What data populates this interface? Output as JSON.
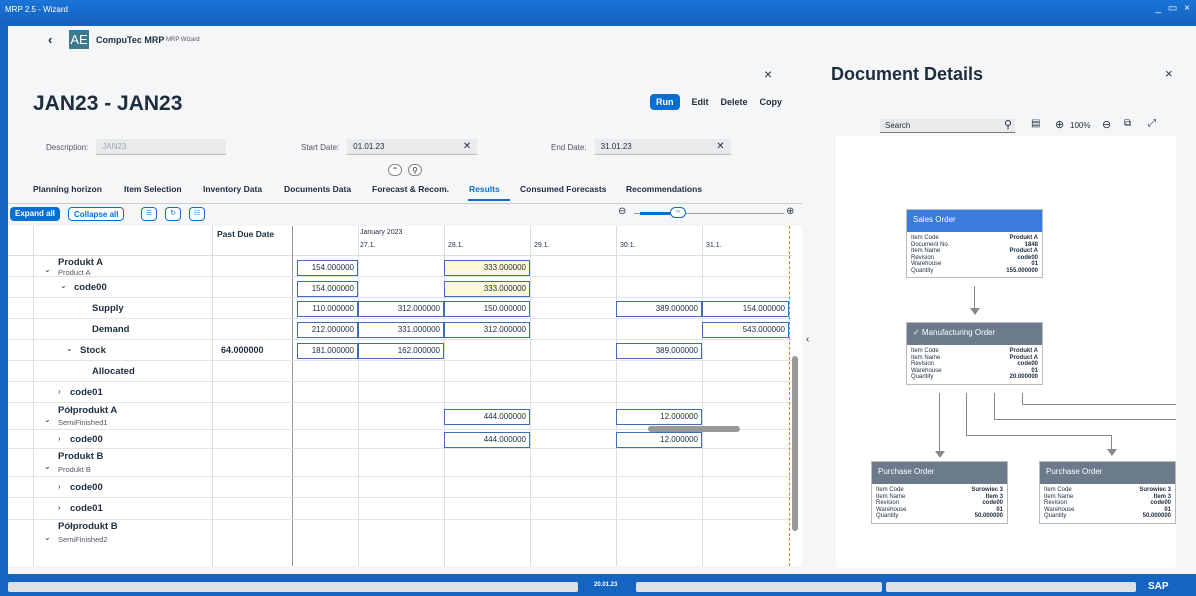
{
  "window_title": "MRP 2.5 - Wizard",
  "window_controls": "_ ▭ ×",
  "app": {
    "back": "‹",
    "logo": "AE",
    "brand": "CompuTec MRP",
    "subtitle": "MRP Wizard"
  },
  "page": {
    "title": "JAN23 - JAN23",
    "close": "×",
    "actions": {
      "run": "Run",
      "edit": "Edit",
      "delete": "Delete",
      "copy": "Copy"
    },
    "fields": {
      "description_label": "Description:",
      "description_value": "JAN23",
      "start_label": "Start Date:",
      "start_value": "01.01.23",
      "end_label": "End Date:",
      "end_value": "31.01.23"
    }
  },
  "tabs": [
    "Planning horizon",
    "Item Selection",
    "Inventory Data",
    "Documents Data",
    "Forecast & Recom.",
    "Results",
    "Consumed Forecasts",
    "Recommendations"
  ],
  "active_tab": "Results",
  "toolbar": {
    "expand_all": "Expand all",
    "collapse_all": "Collapse all"
  },
  "grid": {
    "past_due_header": "Past Due Date",
    "month": "January 2023",
    "days": [
      "27.1.",
      "28.1.",
      "29.1.",
      "30.1.",
      "31.1."
    ],
    "rows": [
      {
        "label": "Produkt A",
        "sub": "Product A"
      },
      {
        "label": "code00"
      },
      {
        "label": "Supply"
      },
      {
        "label": "Demand"
      },
      {
        "label": "Stock",
        "past_due": "64.000000"
      },
      {
        "label": "Allocated"
      },
      {
        "label": "code01"
      },
      {
        "label": "Półprodukt A",
        "sub": "SemiFinished1"
      },
      {
        "label": "code00"
      },
      {
        "label": "Produkt B",
        "sub": "Produkt B"
      },
      {
        "label": "code00"
      },
      {
        "label": "code01"
      },
      {
        "label": "Półprodukt B",
        "sub": "SemiFinished2"
      }
    ],
    "values": [
      "154.000000",
      "333.000000",
      "154.000000",
      "333.000000",
      "110.000000",
      "312.000000",
      "150.000000",
      "389.000000",
      "154.000000",
      "212.000000",
      "331.000000",
      "312.000000",
      "543.000000",
      "181.000000",
      "162.000000",
      "389.000000",
      "444.000000",
      "12.000000",
      "444.000000",
      "12.000000"
    ]
  },
  "details": {
    "title": "Document Details",
    "close": "×",
    "search_placeholder": "Search",
    "zoom": "100%",
    "sales_order": {
      "title": "Sales Order",
      "fields": [
        [
          "Item Code",
          "Produkt A"
        ],
        [
          "Document No.",
          "1848"
        ],
        [
          "Item Name",
          "Product A"
        ],
        [
          "Revision",
          "code00"
        ],
        [
          "Warehouse",
          "01"
        ],
        [
          "Quantity",
          "155.000000"
        ]
      ]
    },
    "manufacturing_order": {
      "title": "✓ Manufacturing Order",
      "fields": [
        [
          "Item Code",
          "Produkt A"
        ],
        [
          "Item Name",
          "Product A"
        ],
        [
          "Revision",
          "code00"
        ],
        [
          "Warehouse",
          "01"
        ],
        [
          "Quantity",
          "20.000000"
        ]
      ]
    },
    "purchase_order_1": {
      "title": "Purchase Order",
      "fields": [
        [
          "Item Code",
          "Surowiec 3"
        ],
        [
          "Item Name",
          "Item 3"
        ],
        [
          "Revision",
          "code00"
        ],
        [
          "Warehouse",
          "01"
        ],
        [
          "Quantity",
          "50.000000"
        ]
      ]
    },
    "purchase_order_2": {
      "title": "Purchase Order",
      "fields": [
        [
          "Item Code",
          "Surowiec 3"
        ],
        [
          "Item Name",
          "Item 3"
        ],
        [
          "Revision",
          "code00"
        ],
        [
          "Warehouse",
          "01"
        ],
        [
          "Quantity",
          "50.000000"
        ]
      ]
    }
  },
  "statusbar": {
    "date": "20.01.23",
    "sap": "SAP"
  },
  "colors": {
    "accent": "#0a6ed1",
    "sales_header": "#3a7bdc",
    "mo_header": "#6b7b8c",
    "po_header": "#6b7b8c"
  }
}
